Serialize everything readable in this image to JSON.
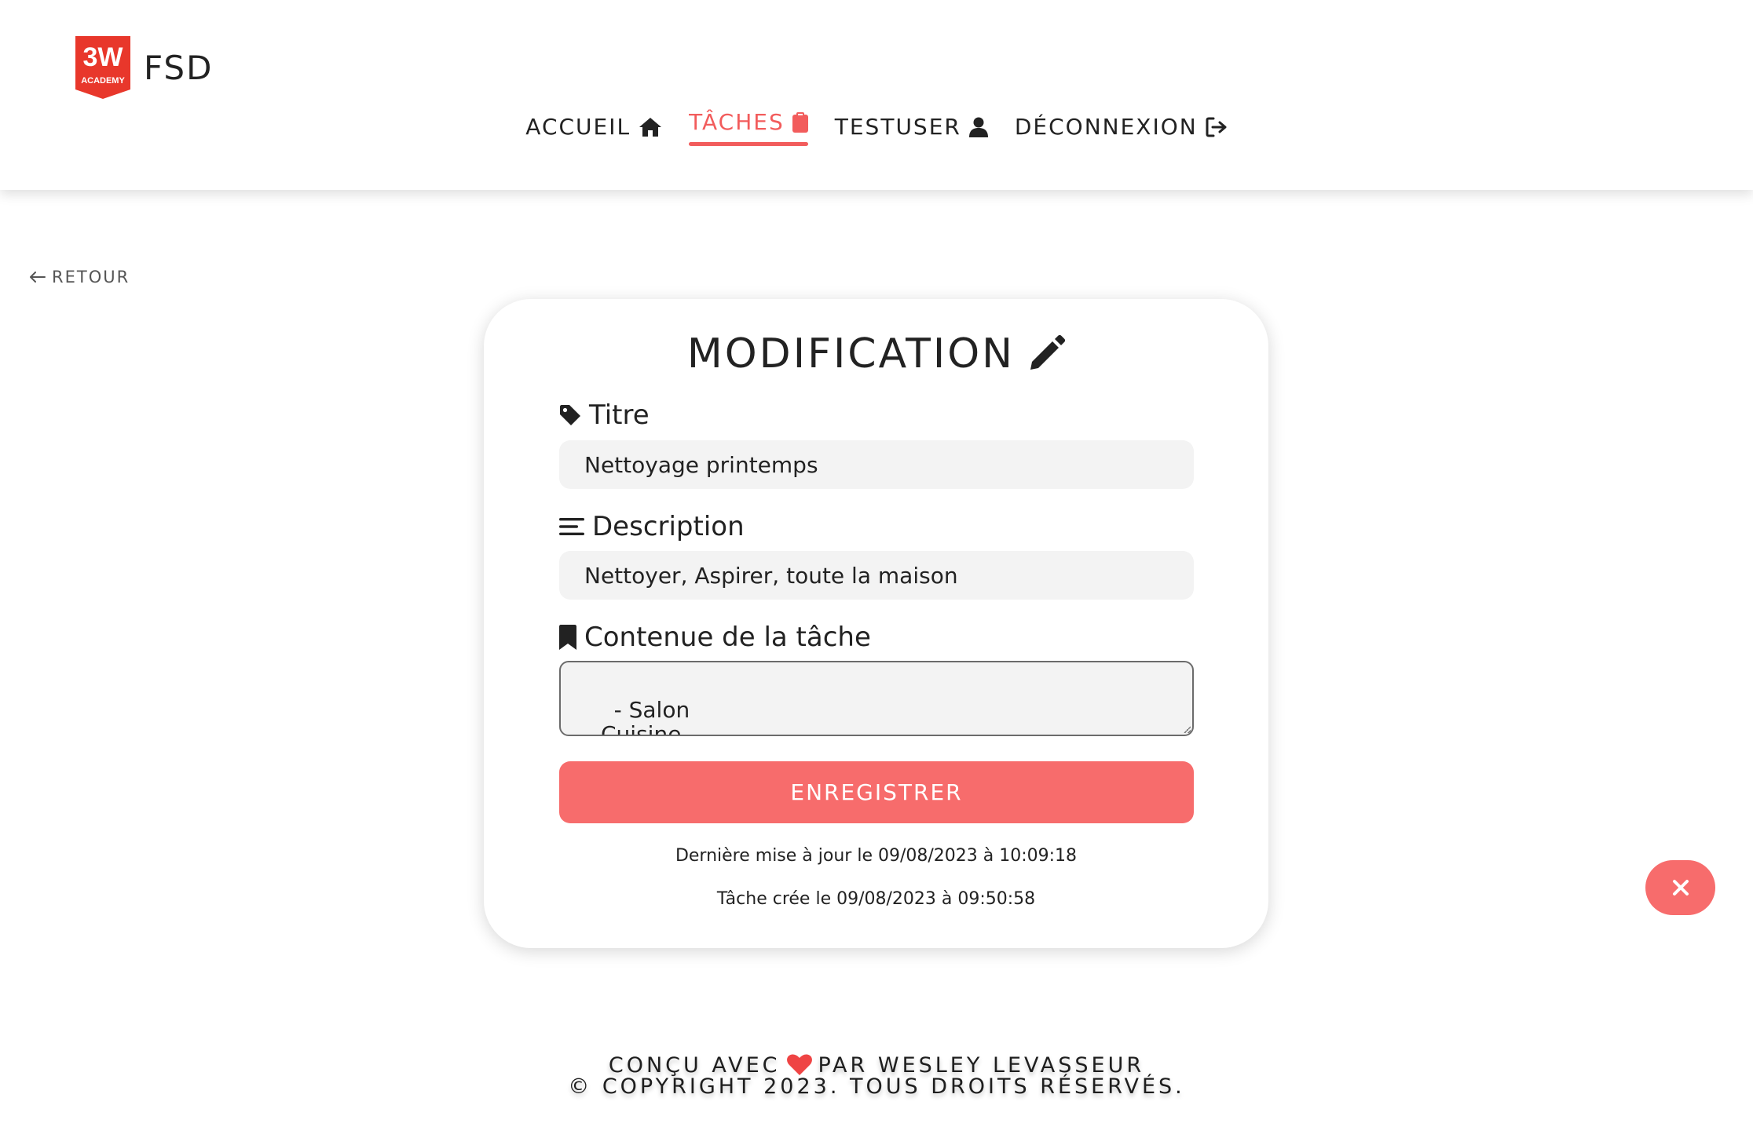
{
  "header": {
    "brand": {
      "logo_text": "3W ACADEMY",
      "name": "FSD"
    },
    "nav": [
      {
        "label": "ACCUEIL",
        "icon": "home-icon",
        "active": false
      },
      {
        "label": "TÂCHES",
        "icon": "clipboard-icon",
        "active": true
      },
      {
        "label": "TESTUSER",
        "icon": "user-icon",
        "active": false
      },
      {
        "label": "DÉCONNEXION",
        "icon": "logout-icon",
        "active": false
      }
    ]
  },
  "back_link": {
    "label": "RETOUR",
    "icon": "arrow-left-icon"
  },
  "form": {
    "title": "MODIFICATION",
    "title_icon": "pencil-icon",
    "fields": {
      "titre": {
        "label": "Titre",
        "icon": "tag-icon",
        "value": "Nettoyage printemps"
      },
      "description": {
        "label": "Description",
        "icon": "lines-icon",
        "value": "Nettoyer, Aspirer, toute la maison"
      },
      "contenu": {
        "label": "Contenue de la tâche",
        "icon": "bookmark-icon",
        "value": "- Salon\n- Cuisine\n- Salle de Bain"
      }
    },
    "save_label": "ENREGISTRER",
    "updated_text": "Dernière mise à jour le 09/08/2023 à 10:09:18",
    "created_text": "Tâche crée le 09/08/2023 à 09:50:58"
  },
  "fab": {
    "icon": "close-icon"
  },
  "footer": {
    "made_prefix": "CONÇU AVEC",
    "made_suffix": "PAR WESLEY LEVASSEUR",
    "copyright": "© COPYRIGHT 2023. TOUS DROITS RÉSERVÉS."
  },
  "colors": {
    "accent": "#f25c5c",
    "button": "#f76c6c",
    "input_bg": "#f3f3f3",
    "logo_red": "#e8372b",
    "text": "#222222"
  }
}
